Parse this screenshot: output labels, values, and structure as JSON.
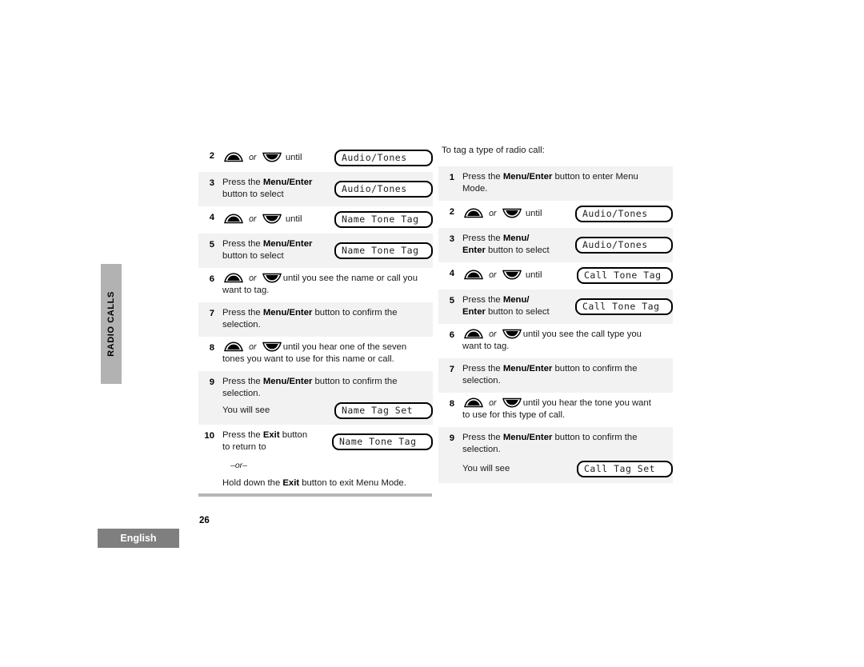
{
  "side_tab": {
    "label": "RADIO CALLS"
  },
  "footer": {
    "language": "English",
    "page_number": "26"
  },
  "left_column": {
    "steps": [
      {
        "num": "2",
        "type": "arrow",
        "shaded": false,
        "pre": "",
        "post": "until",
        "lcd": "Audio/Tones"
      },
      {
        "num": "3",
        "type": "text2",
        "shaded": true,
        "line1_a": "Press the ",
        "line1_b": "Menu/Enter",
        "line1_c": "",
        "line2": "button to select",
        "lcd": "Audio/Tones"
      },
      {
        "num": "4",
        "type": "arrow",
        "shaded": false,
        "pre": "",
        "post": "until",
        "lcd": "Name Tone Tag"
      },
      {
        "num": "5",
        "type": "text2",
        "shaded": true,
        "line1_a": "Press the ",
        "line1_b": "Menu/Enter",
        "line1_c": "",
        "line2": "button to select",
        "lcd": "Name Tone Tag"
      },
      {
        "num": "6",
        "type": "arrow-wrap",
        "shaded": false,
        "post": "until you see the name or call you",
        "line2": "want to tag."
      },
      {
        "num": "7",
        "type": "plain",
        "shaded": true,
        "line1_a": "Press the ",
        "line1_b": "Menu/Enter",
        "line1_c": " button to confirm the",
        "line2": "selection."
      },
      {
        "num": "8",
        "type": "arrow-wrap",
        "shaded": false,
        "post": "until you hear one of the seven",
        "line2": "tones you want to use for this name or call."
      },
      {
        "num": "9",
        "type": "plain-lcd",
        "shaded": true,
        "line1_a": "Press the ",
        "line1_b": "Menu/Enter",
        "line1_c": " button to confirm the",
        "line2": "selection.",
        "line3": "You will see",
        "lcd": "Name Tag Set"
      },
      {
        "num": "10",
        "type": "exit",
        "shaded": false,
        "line1_a": "Press the ",
        "line1_b": "Exit",
        "line1_c": " button",
        "line2": "to return to",
        "lcd": "Name Tone Tag",
        "dashor": "–or–",
        "tail_a": "Hold down the ",
        "tail_b": "Exit",
        "tail_c": " button to exit Menu Mode."
      }
    ]
  },
  "right_column": {
    "intro": "To tag a type of radio call:",
    "steps": [
      {
        "num": "1",
        "type": "plain",
        "shaded": true,
        "line1_a": "Press the ",
        "line1_b": "Menu/Enter",
        "line1_c": " button to enter Menu",
        "line2": "Mode."
      },
      {
        "num": "2",
        "type": "arrow",
        "shaded": false,
        "post": "until",
        "lcd": "Audio/Tones"
      },
      {
        "num": "3",
        "type": "text2",
        "shaded": true,
        "line1_a": "Press the ",
        "line1_b": "Menu/",
        "line1_c": "",
        "line2_b": "Enter",
        "line2_c": " button to select",
        "lcd": "Audio/Tones"
      },
      {
        "num": "4",
        "type": "arrow",
        "shaded": false,
        "post": "until",
        "lcd": "Call Tone Tag"
      },
      {
        "num": "5",
        "type": "text2",
        "shaded": true,
        "line1_a": "Press the ",
        "line1_b": "Menu/",
        "line1_c": "",
        "line2_b": "Enter",
        "line2_c": " button to select",
        "lcd": "Call Tone Tag"
      },
      {
        "num": "6",
        "type": "arrow-wrap",
        "shaded": false,
        "post": "until you see the call type you",
        "line2": "want to tag."
      },
      {
        "num": "7",
        "type": "plain",
        "shaded": true,
        "line1_a": "Press the ",
        "line1_b": "Menu/Enter",
        "line1_c": " button to confirm the",
        "line2": "selection."
      },
      {
        "num": "8",
        "type": "arrow-wrap",
        "shaded": false,
        "post": "until you hear the tone you want",
        "line2": "to use for this type of call."
      },
      {
        "num": "9",
        "type": "plain-lcd",
        "shaded": true,
        "line1_a": "Press the ",
        "line1_b": "Menu/Enter",
        "line1_c": " button to confirm the",
        "line2": "selection.",
        "line3": "You will see",
        "lcd": "Call Tag Set"
      }
    ]
  },
  "icons": {
    "up_arrow": "up-arrow-button-icon",
    "down_arrow": "down-arrow-button-icon",
    "or_word": "or"
  },
  "colors": {
    "side_tab_gray": "#b2b2b2",
    "language_tab_gray": "#7f7f7f",
    "row_shade": "#f2f2f2",
    "rule_gray": "#b5b5b5"
  }
}
